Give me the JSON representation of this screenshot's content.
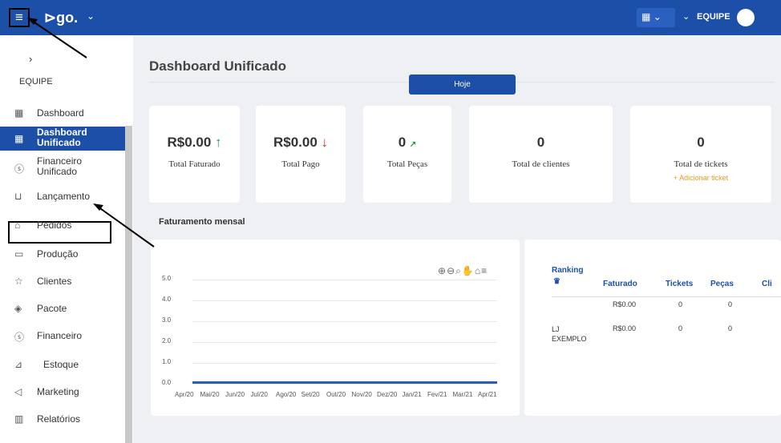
{
  "header": {
    "logo": "⊳go.",
    "team_label": "EQUIPE"
  },
  "sidebar": {
    "team_label": "EQUIPE",
    "items": [
      {
        "label": "Dashboard",
        "icon": "grid-icon"
      },
      {
        "label": "Dashboard Unificado",
        "icon": "grid-icon"
      },
      {
        "label": "Financeiro Unificado",
        "icon": "dollar-circle-icon"
      },
      {
        "label": "Lançamento",
        "icon": "cart-icon"
      },
      {
        "label": "Pedidos",
        "icon": "shirt-icon"
      },
      {
        "label": "Produção",
        "icon": "truck-icon"
      },
      {
        "label": "Clientes",
        "icon": "star-icon"
      },
      {
        "label": "Pacote",
        "icon": "package-icon"
      },
      {
        "label": "Financeiro",
        "icon": "dollar-circle-icon"
      },
      {
        "label": "Estoque",
        "icon": "dolly-icon"
      },
      {
        "label": "Marketing",
        "icon": "megaphone-icon"
      },
      {
        "label": "Relatórios",
        "icon": "chart-icon"
      }
    ]
  },
  "main": {
    "title": "Dashboard Unificado",
    "period_button": "Hoje",
    "cards": [
      {
        "value": "R$0.00",
        "label": "Total Faturado",
        "trend": "↑"
      },
      {
        "value": "R$0.00",
        "label": "Total Pago",
        "trend": "↓"
      },
      {
        "value": "0",
        "label": "Total Peças",
        "trend": "↗"
      },
      {
        "value": "0",
        "label": "Total de clientes"
      },
      {
        "value": "0",
        "label": "Total de tickets",
        "action": "+ Adicionar ticket"
      }
    ],
    "section_title": "Faturamento mensal"
  },
  "chart_data": {
    "type": "line",
    "categories": [
      "Apr/20",
      "Mai/20",
      "Jun/20",
      "Jul/20",
      "Ago/20",
      "Set/20",
      "Out/20",
      "Nov/20",
      "Dez/20",
      "Jan/21",
      "Fev/21",
      "Mar/21",
      "Apr/21"
    ],
    "values": [
      0,
      0,
      0,
      0,
      0,
      0,
      0,
      0,
      0,
      0,
      0,
      0,
      0
    ],
    "y_ticks": [
      "5.0",
      "4.0",
      "3.0",
      "2.0",
      "1.0",
      "0.0"
    ],
    "ylim": [
      0,
      5
    ],
    "color": "#2a5fb0"
  },
  "ranking": {
    "title": "Ranking",
    "columns": [
      "Faturado",
      "Tickets",
      "Peças",
      "Cli"
    ],
    "rows": [
      {
        "name": "",
        "faturado": "R$0.00",
        "tickets": "0",
        "pecas": "0"
      },
      {
        "name": "LJ EXEMPLO",
        "faturado": "R$0.00",
        "tickets": "0",
        "pecas": "0"
      }
    ]
  }
}
